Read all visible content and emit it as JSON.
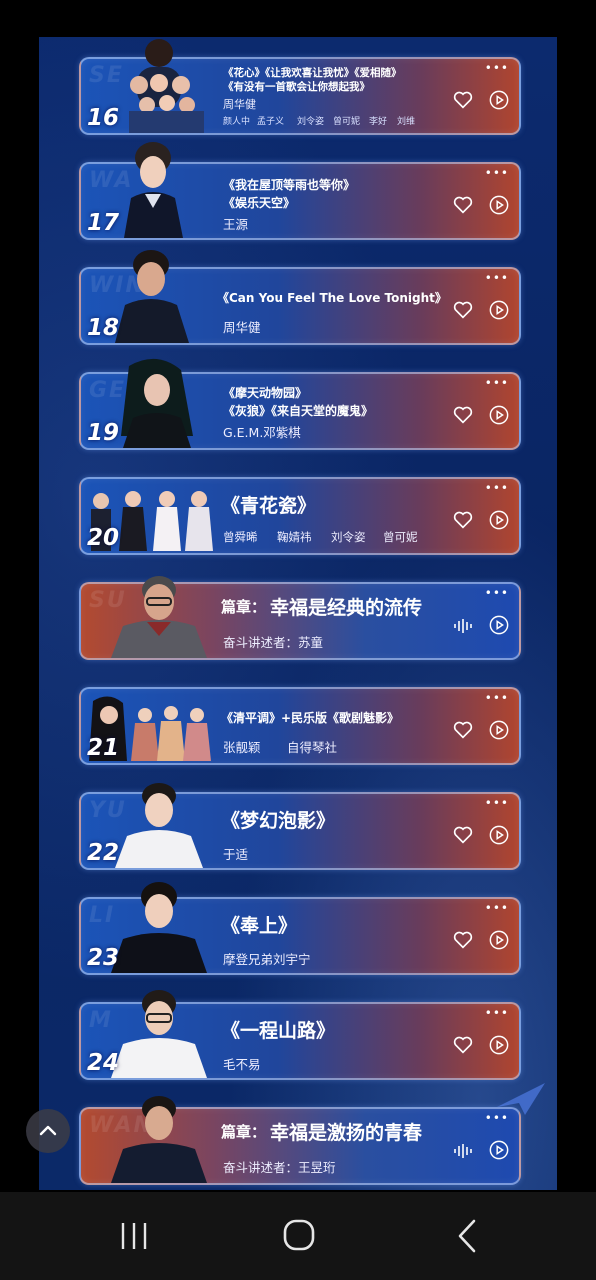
{
  "cards": [
    {
      "num": "16",
      "songs": [
        "《花心》《让我欢喜让我忧》《爱相随》",
        "《有没有一首歌会让你想起我》"
      ],
      "singer": "周华健",
      "guests": [
        "颜人中",
        "孟子义",
        "刘令姿",
        "曾可妮",
        "李好",
        "刘维"
      ],
      "ghost": "SE"
    },
    {
      "num": "17",
      "songs": [
        "《我在屋顶等雨也等你》",
        "《娱乐天空》"
      ],
      "singer": "王源",
      "ghost": "WA"
    },
    {
      "num": "18",
      "songs": [
        "《Can You Feel The Love Tonight》"
      ],
      "singer": "周华健",
      "ghost": "WIN"
    },
    {
      "num": "19",
      "songs": [
        "《摩天动物园》",
        "《灰狼》《来自天堂的魔鬼》"
      ],
      "singer": "G.E.M.邓紫棋",
      "ghost": "GE"
    },
    {
      "num": "20",
      "songs": [
        "《青花瓷》"
      ],
      "singer_parts": [
        "曾舜晞",
        "鞠婧祎",
        "刘令姿",
        "曾可妮"
      ],
      "ghost": ""
    },
    {
      "chapter": true,
      "prefix": "篇章：",
      "title": "幸福是经典的流传",
      "narrator": "奋斗讲述者：苏童",
      "ghost": "SU"
    },
    {
      "num": "21",
      "songs": [
        "《清平调》+民乐版《歌剧魅影》"
      ],
      "singer_parts": [
        "张靓颖",
        "自得琴社"
      ],
      "ghost": ""
    },
    {
      "num": "22",
      "songs": [
        "《梦幻泡影》"
      ],
      "singer": "于适",
      "ghost": "YU"
    },
    {
      "num": "23",
      "songs": [
        "《奉上》"
      ],
      "singer": "摩登兄弟刘宇宁",
      "ghost": "LI"
    },
    {
      "num": "24",
      "songs": [
        "《一程山路》"
      ],
      "singer": "毛不易",
      "ghost": "M"
    },
    {
      "chapter": true,
      "prefix": "篇章：",
      "title": "幸福是激扬的青春",
      "narrator": "奋斗讲述者：王昱珩",
      "ghost": "WANG"
    }
  ],
  "colors": {
    "card_left": "#1b54b8",
    "card_right": "#b0452f",
    "panel": "#0a2563"
  },
  "icons": {
    "more": "more-icon",
    "like": "heart-icon",
    "play": "play-icon",
    "audio": "sound-wave-icon",
    "scroll_top": "chevron-up-icon"
  }
}
